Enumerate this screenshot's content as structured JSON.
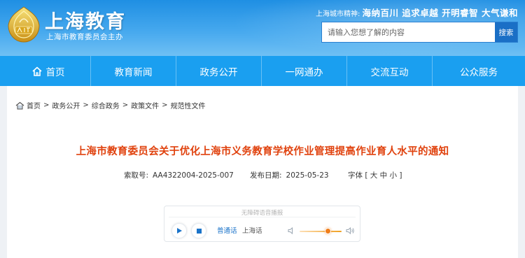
{
  "header": {
    "title": "上海教育",
    "subtitle": "上海市教育委员会主办",
    "logo_icon": "shanghai-education-emblem",
    "spirit_label": "上海城市精神:",
    "spirit_text": "海纳百川 追求卓越 开明睿智 大气谦和",
    "search": {
      "placeholder": "请输入您想了解的内容",
      "value": "",
      "button_label": "搜索"
    }
  },
  "nav": {
    "home_icon": "home-icon",
    "items": [
      {
        "label": "首页"
      },
      {
        "label": "教育新闻"
      },
      {
        "label": "政务公开"
      },
      {
        "label": "一网通办"
      },
      {
        "label": "交流互动"
      },
      {
        "label": "公众服务"
      }
    ]
  },
  "breadcrumb": {
    "icon": "home-icon",
    "items": [
      "首页",
      "政务公开",
      "综合政务",
      "政策文件",
      "规范性文件"
    ],
    "separator": ">"
  },
  "article": {
    "title": "上海市教育委员会关于优化上海市义务教育学校作业管理提高作业育人水平的通知",
    "index_label": "索取号:",
    "index_value": "AA4322004-2025-007",
    "date_label": "发布日期:",
    "date_value": "2025-05-23",
    "font_label": "字体",
    "font_open": "[",
    "font_large": "大",
    "font_medium": "中",
    "font_small": "小",
    "font_close": "]"
  },
  "player": {
    "hint": "无障碍语音播报",
    "play_icon": "play-icon",
    "stop_icon": "stop-icon",
    "lang_1": "普通话",
    "lang_2": "上海话",
    "volume_level": 0.67,
    "accent_color": "#1a73c9",
    "volume_color": "#f07d1a"
  },
  "colors": {
    "header_blue": "#1f8fe3",
    "nav_blue": "#1a9ff0",
    "title_red": "#e0420e"
  }
}
